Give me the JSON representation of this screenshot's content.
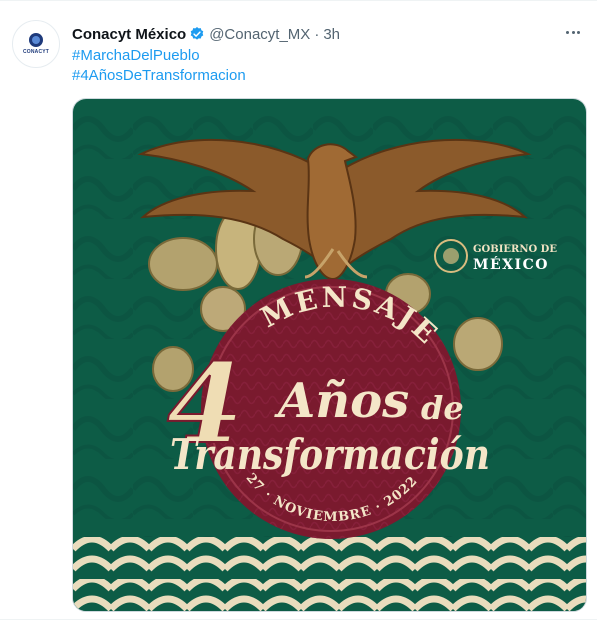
{
  "tweet": {
    "author_name": "Conacyt México",
    "handle": "@Conacyt_MX",
    "separator": "·",
    "time": "3h",
    "hashtags": [
      "#MarchaDelPueblo",
      "#4AñosDeTransformacion"
    ],
    "avatar_text": "CONACYT"
  },
  "media": {
    "gov_line1": "GOBIERNO DE",
    "gov_line2": "MÉXICO",
    "mensaje": "MENSAJE",
    "number": "4",
    "anos": "Años",
    "de": "de",
    "transformacion": "Transformación",
    "date": "27 · NOVIEMBRE · 2022"
  },
  "colors": {
    "accent": "#1d9bf0",
    "muted": "#536471",
    "green": "#0d5c46",
    "maroon": "#7a1a2e",
    "gold": "#d9bc7f"
  },
  "icons": {
    "verified": "verified-badge-icon",
    "more": "more-options-icon",
    "eagle": "eagle-icon",
    "shield": "national-shield-icon"
  }
}
